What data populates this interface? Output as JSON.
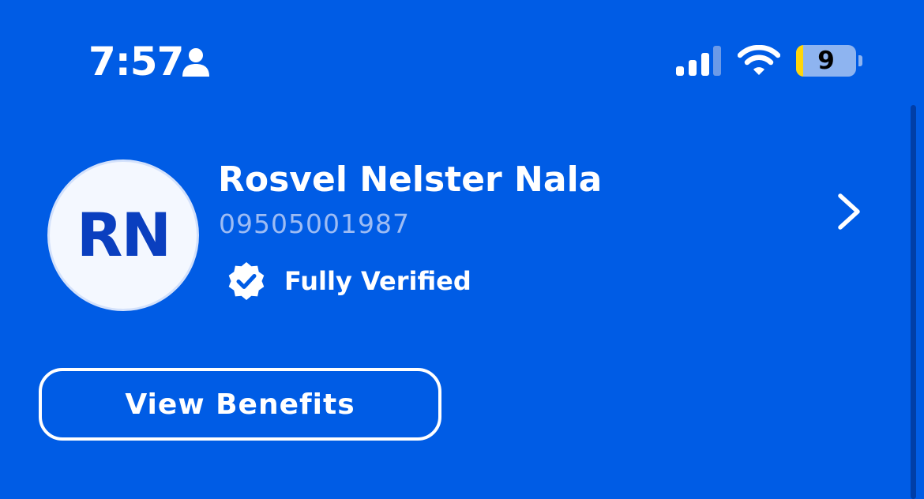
{
  "status_bar": {
    "time": "7:57",
    "battery_level": "9",
    "icons": [
      "person-icon",
      "signal-icon",
      "wifi-icon",
      "battery-icon"
    ]
  },
  "profile": {
    "avatar_initials": "RN",
    "name": "Rosvel Nelster Nala",
    "phone": "09505001987",
    "verification_status": "Fully Verified",
    "icons": [
      "verified-badge-icon",
      "chevron-right-icon"
    ]
  },
  "actions": {
    "view_benefits_label": "View Benefits"
  },
  "colors": {
    "background": "#005ce5",
    "text": "#ffffff",
    "phone_text": "#9dbcf4",
    "avatar_bg": "#f4f8ff",
    "avatar_text": "#0a3fbf",
    "battery_bg": "#8eb4f0",
    "battery_fill": "#ffd60a"
  }
}
